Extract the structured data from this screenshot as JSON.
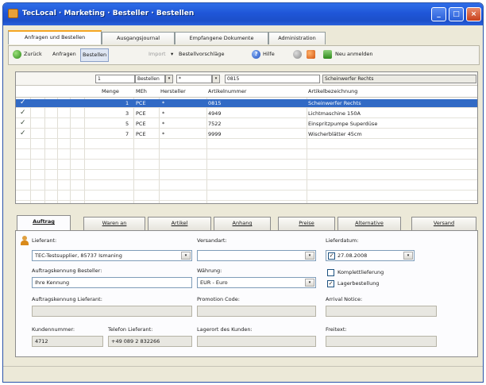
{
  "window": {
    "title": "TecLocal · Marketing · Besteller · Bestellen",
    "buttons": {
      "minimize": "_",
      "maximize": "□",
      "close": "×"
    }
  },
  "main_tabs": [
    {
      "label": "Anfragen und Bestellen",
      "active": true
    },
    {
      "label": "Ausgangsjournal",
      "active": false
    },
    {
      "label": "Empfangene Dokumente",
      "active": false
    },
    {
      "label": "Administration",
      "active": false
    }
  ],
  "toolbar": {
    "back": "Zurück",
    "inquire": "Anfragen",
    "order": "Bestellen",
    "import": "Import",
    "suggestions": "Bestellvorschläge",
    "help": "Hilfe",
    "new_login": "Neu anmelden"
  },
  "filter": {
    "menge": "1",
    "mode": "Bestellen",
    "hersteller": "*",
    "artikelnummer": "0815",
    "bezeichnung": "Scheinwerfer Rechts",
    "drop": "▾"
  },
  "grid": {
    "columns": [
      "Menge",
      "MEh",
      "Hersteller",
      "Artikelnummer",
      "Artikelbezeichnung"
    ],
    "rows": [
      {
        "check": "✓",
        "menge": "1",
        "meh": "PCE",
        "hersteller": "*",
        "artnr": "0815",
        "bez": "Scheinwerfer Rechts",
        "selected": true
      },
      {
        "check": "✓",
        "menge": "3",
        "meh": "PCE",
        "hersteller": "*",
        "artnr": "4949",
        "bez": "Lichtmaschine 150A",
        "selected": false
      },
      {
        "check": "✓",
        "menge": "5",
        "meh": "PCE",
        "hersteller": "*",
        "artnr": "7522",
        "bez": "Einspritzpumpe Superdüse",
        "selected": false
      },
      {
        "check": "✓",
        "menge": "7",
        "meh": "PCE",
        "hersteller": "*",
        "artnr": "9999",
        "bez": "Wischerblätter 45cm",
        "selected": false
      }
    ]
  },
  "detail_tabs": [
    "Auftrag",
    "Waren an",
    "Artikel",
    "Anhang",
    "Preise",
    "Alternative",
    "Versand"
  ],
  "detail": {
    "lieferant_label": "Lieferant:",
    "lieferant_value": "TEC-Testsupplier, 85737 Ismaning",
    "versandart_label": "Versandart:",
    "versandart_value": "",
    "lieferdatum_label": "Lieferdatum:",
    "lieferdatum_value": "27.08.2008",
    "lieferdatum_check": "✓",
    "auftragsbest_label": "Auftragskennung Besteller:",
    "auftragsbest_value": "Ihre Kennung",
    "waehrung_label": "Währung:",
    "waehrung_value": "EUR - Euro",
    "komplett_label": "Komplettlieferung",
    "komplett_check": "",
    "lager_label": "Lagerbestellung",
    "lager_check": "✓",
    "auftragslief_label": "Auftragskennung Lieferant:",
    "promotion_label": "Promotion Code:",
    "arrival_label": "Arrival Notice:",
    "kundennr_label": "Kundennummer:",
    "kundennr_value": "4712",
    "telefon_label": "Telefon Lieferant:",
    "telefon_value": "+49 089 2 832266",
    "lagerort_label": "Lagerort des Kunden:",
    "freitext_label": "Freitext:",
    "drop": "▾"
  }
}
